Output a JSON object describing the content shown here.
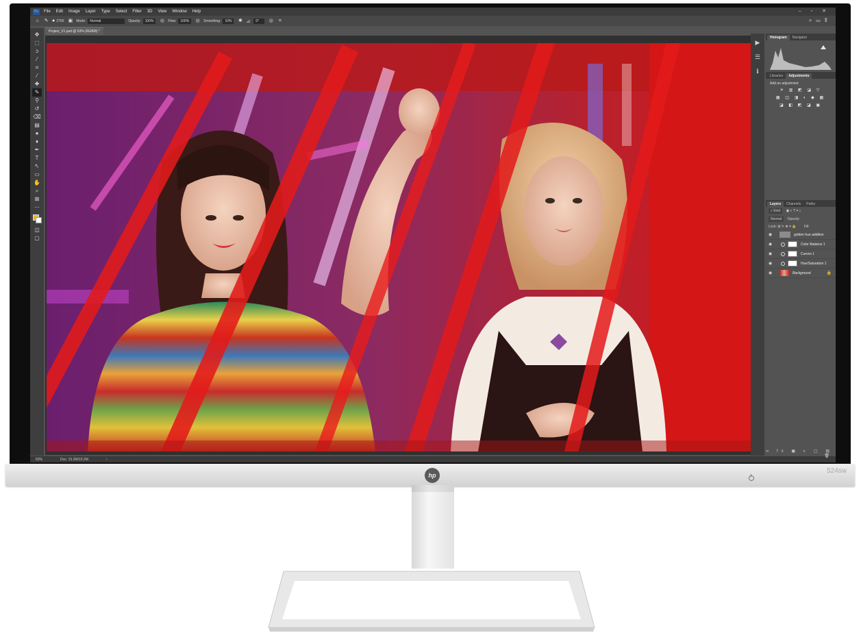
{
  "app": {
    "badge": "Ps",
    "menu": [
      "File",
      "Edit",
      "Image",
      "Layer",
      "Type",
      "Select",
      "Filter",
      "3D",
      "View",
      "Window",
      "Help"
    ],
    "window_controls": "– ▫ ✕"
  },
  "options_bar": {
    "brush_size": "2700",
    "mode_label": "Mode:",
    "mode_value": "Normal",
    "opacity_label": "Opacity:",
    "opacity_value": "100%",
    "flow_label": "Flow:",
    "flow_value": "100%",
    "smoothing_label": "Smoothing:",
    "smoothing_value": "10%",
    "angle_value": "0°"
  },
  "document": {
    "tab_title": "Project_V1.psd @ 63% (RGB/8) *",
    "zoom": "63%",
    "doc_size": "Doc: 15.2M/15.2M",
    "status_arrow": "›"
  },
  "panels": {
    "top_tabs": [
      "Histogram",
      "Navigator"
    ],
    "mid_tabs": [
      "Libraries",
      "Adjustments"
    ],
    "add_adjustment": "Add an adjustment",
    "layer_tabs": [
      "Layers",
      "Channels",
      "Paths"
    ],
    "kind_filter": "Kind",
    "blend_mode": "Normal",
    "opacity_label": "Opacity:",
    "lock_label": "Lock:",
    "fill_label": "Fill:",
    "layers": [
      {
        "name": "golden hue addition",
        "type": "text"
      },
      {
        "name": "Color Balance 1",
        "type": "adjustment"
      },
      {
        "name": "Curves 1",
        "type": "adjustment"
      },
      {
        "name": "Hue/Saturation 1",
        "type": "adjustment"
      },
      {
        "name": "Background",
        "type": "background"
      }
    ]
  },
  "monitor": {
    "brand": "hp",
    "model": "524sw"
  },
  "colors": {
    "accent_red": "#d21818",
    "foreground_swatch": "#f2b233",
    "ps_blue": "#2b5797"
  }
}
